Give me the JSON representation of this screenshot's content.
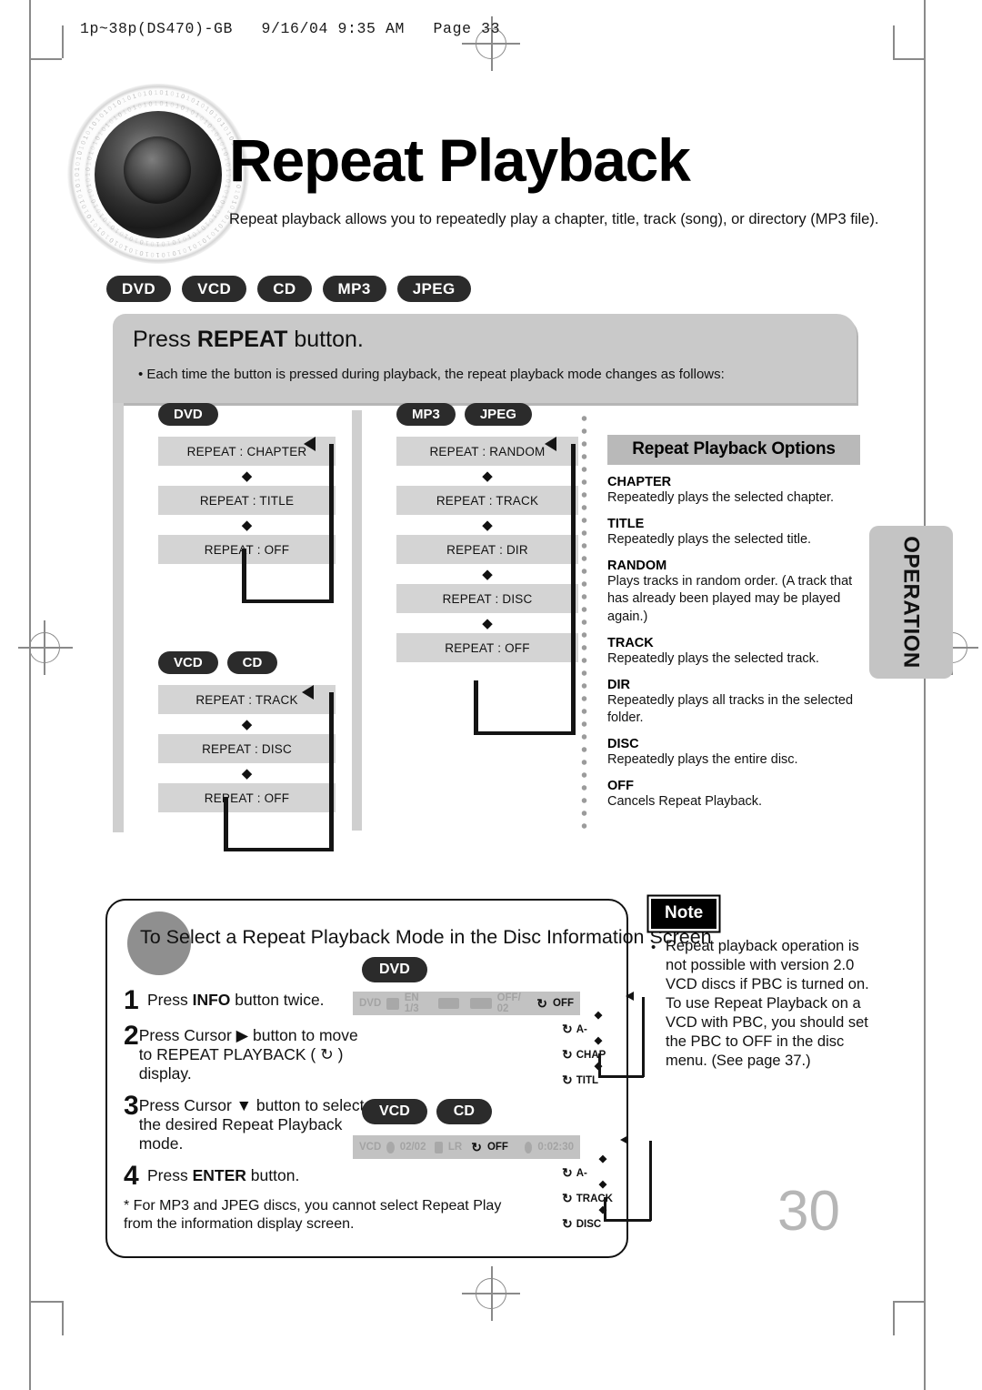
{
  "print": {
    "slug": "1p~38p(DS470)-GB   9/16/04 9:35 AM   Page 33"
  },
  "hero": {
    "title": "Repeat Playback",
    "subtitle": "Repeat playback allows you to repeatedly play a chapter, title, track (song), or directory (MP3 file).",
    "logo_icon": "speaker-icon"
  },
  "format_badges": [
    "DVD",
    "VCD",
    "CD",
    "MP3",
    "JPEG"
  ],
  "press_panel": {
    "title_pre": "Press ",
    "title_strong": "REPEAT",
    "title_post": " button.",
    "bullet": "• Each time the button is pressed during playback, the repeat playback mode changes as follows:"
  },
  "flows": [
    {
      "id": "dvd",
      "badges": [
        "DVD"
      ],
      "nodes": [
        "REPEAT : CHAPTER",
        "REPEAT : TITLE",
        "REPEAT : OFF"
      ]
    },
    {
      "id": "vcd-cd",
      "badges": [
        "VCD",
        "CD"
      ],
      "nodes": [
        "REPEAT : TRACK",
        "REPEAT : DISC",
        "REPEAT : OFF"
      ]
    },
    {
      "id": "mp3-jpeg",
      "badges": [
        "MP3",
        "JPEG"
      ],
      "nodes": [
        "REPEAT : RANDOM",
        "REPEAT : TRACK",
        "REPEAT : DIR",
        "REPEAT : DISC",
        "REPEAT : OFF"
      ]
    }
  ],
  "options": {
    "heading": "Repeat Playback Options",
    "items": [
      {
        "term": "CHAPTER",
        "desc": "Repeatedly plays the selected chapter."
      },
      {
        "term": "TITLE",
        "desc": "Repeatedly plays the selected title."
      },
      {
        "term": "RANDOM",
        "desc": "Plays tracks in random order.\n(A track that has already been played may be played again.)"
      },
      {
        "term": "TRACK",
        "desc": "Repeatedly plays the selected track."
      },
      {
        "term": "DIR",
        "desc": "Repeatedly plays all tracks in the selected folder."
      },
      {
        "term": "DISC",
        "desc": "Repeatedly plays the entire disc."
      },
      {
        "term": "OFF",
        "desc": "Cancels Repeat Playback."
      }
    ]
  },
  "side_tab": {
    "label": "OPERATION"
  },
  "lower": {
    "title": "To Select a Repeat Playback Mode in the Disc Information Screen",
    "steps": [
      {
        "num": "1",
        "text_parts": [
          {
            "t": "Press ",
            "b": false
          },
          {
            "t": "INFO",
            "b": true
          },
          {
            "t": " button twice.",
            "b": false
          }
        ]
      },
      {
        "num": "2",
        "text_parts": [
          {
            "t": "Press Cursor ▶ button to move to REPEAT PLAYBACK ( ↻ ) display.",
            "b": false
          }
        ]
      },
      {
        "num": "3",
        "text_parts": [
          {
            "t": "Press Cursor ▼ button to select the desired Repeat Playback mode.",
            "b": false
          }
        ]
      },
      {
        "num": "4",
        "text_parts": [
          {
            "t": "Press ",
            "b": false
          },
          {
            "t": "ENTER",
            "b": true
          },
          {
            "t": " button.",
            "b": false
          }
        ]
      }
    ],
    "footnote": "* For MP3 and JPEG discs, you cannot select Repeat Play from the information display screen.",
    "dvd_display": {
      "badges": [
        "DVD"
      ],
      "bar": {
        "type": "DVD",
        "subtitle": "EN 1/3",
        "audio": "OFF/ 02",
        "repeat": "OFF"
      },
      "menu": [
        "OFF",
        "A-",
        "CHAP",
        "TITL"
      ]
    },
    "vcd_display": {
      "badges": [
        "VCD",
        "CD"
      ],
      "bar": {
        "type": "VCD",
        "track": "02/02",
        "audio": "LR",
        "repeat": "OFF",
        "time": "0:02:30"
      },
      "menu": [
        "OFF",
        "A-",
        "TRACK",
        "DISC"
      ]
    }
  },
  "note": {
    "tag": "Note",
    "body": "Repeat playback operation is not possible with version 2.0 VCD discs if PBC is turned on. To use Repeat Playback on a VCD with PBC, you should set the PBC to OFF in the disc menu. (See page 37.)"
  },
  "page_number": "30"
}
